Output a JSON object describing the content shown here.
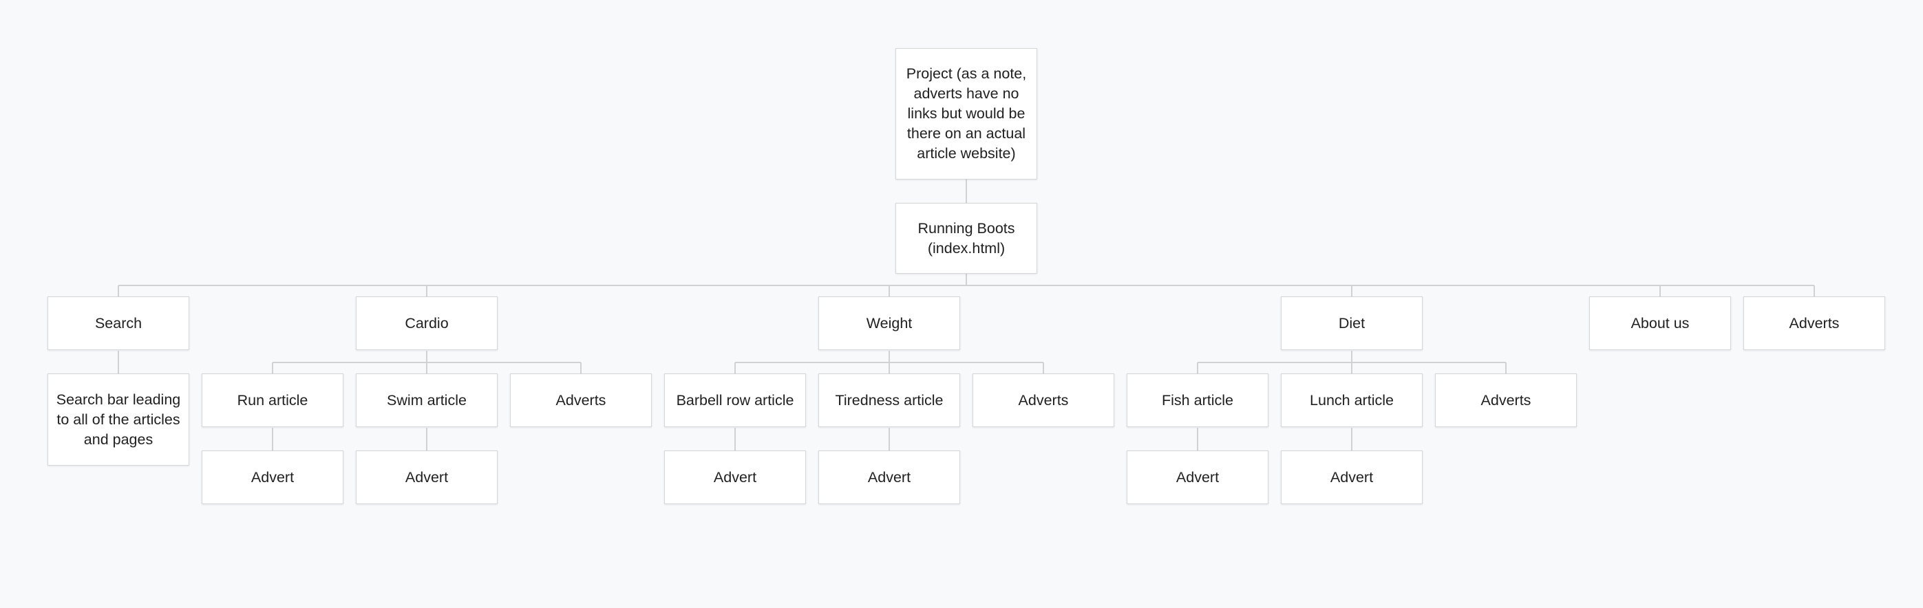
{
  "sitemap": {
    "root": "Project (as a note, adverts have no links but would be there on an actual article website)",
    "home": "Running Boots (index.html)",
    "search": {
      "label": "Search",
      "child": "Search bar leading to all of the articles and pages"
    },
    "cardio": {
      "label": "Cardio",
      "run_article": "Run article",
      "run_advert": "Advert",
      "swim_article": "Swim article",
      "swim_advert": "Advert",
      "adverts": "Adverts"
    },
    "weight": {
      "label": "Weight",
      "barbell_article": "Barbell row article",
      "barbell_advert": "Advert",
      "tiredness_article": "Tiredness article",
      "tiredness_advert": "Advert",
      "adverts": "Adverts"
    },
    "diet": {
      "label": "Diet",
      "fish_article": "Fish article",
      "fish_advert": "Advert",
      "lunch_article": "Lunch article",
      "lunch_advert": "Advert",
      "adverts": "Adverts"
    },
    "about": "About us",
    "adverts": "Adverts"
  }
}
